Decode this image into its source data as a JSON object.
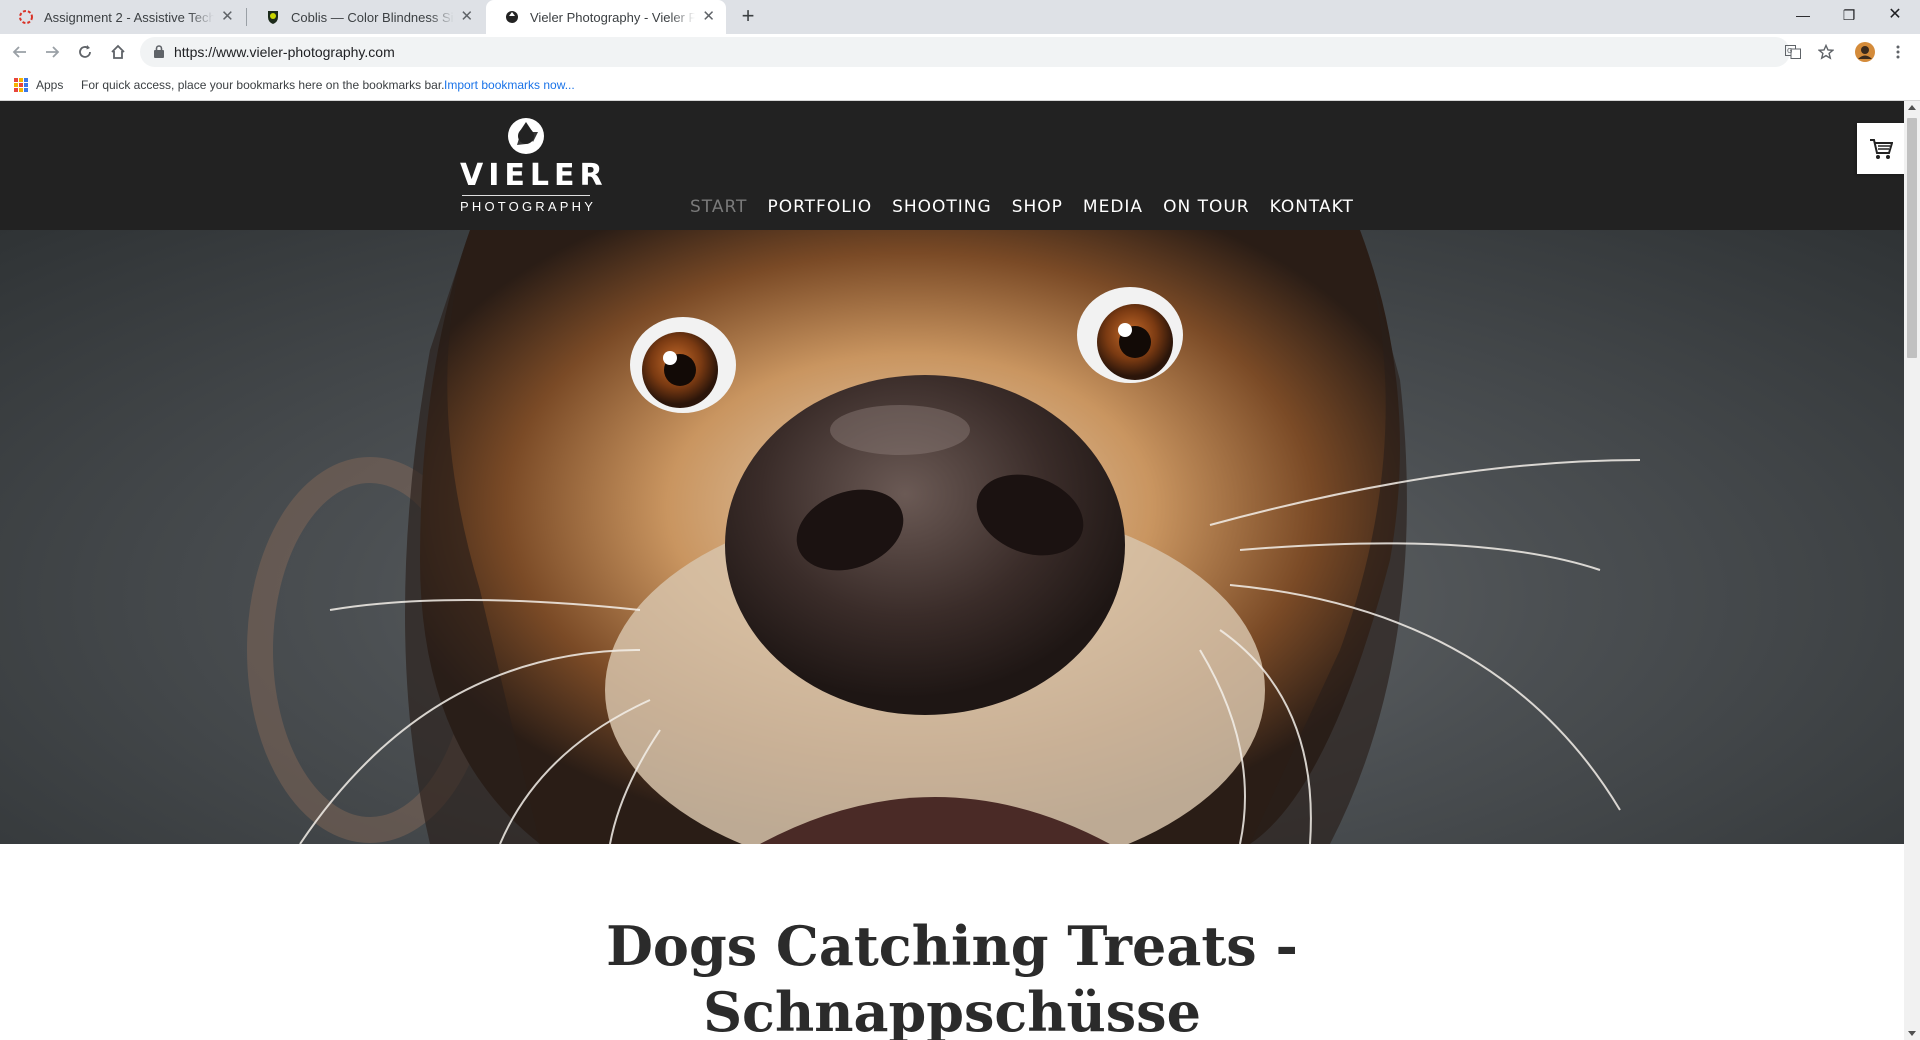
{
  "browser": {
    "tabs": [
      {
        "title": "Assignment 2 - Assistive Technology",
        "favicon": "red-ring-icon",
        "active": false
      },
      {
        "title": "Coblis — Color Blindness Simulator",
        "favicon": "coblis-icon",
        "active": false
      },
      {
        "title": "Vieler Photography - Vieler Photography",
        "favicon": "aperture-icon",
        "active": true
      }
    ],
    "url": "https://www.vieler-photography.com",
    "bookmarks_bar": {
      "apps_label": "Apps",
      "hint": "For quick access, place your bookmarks here on the bookmarks bar.",
      "import_link": "Import bookmarks now..."
    }
  },
  "site": {
    "logo": {
      "main": "VIELER",
      "sub": "PHOTOGRAPHY"
    },
    "nav": [
      {
        "label": "START",
        "current": true
      },
      {
        "label": "PORTFOLIO",
        "current": false
      },
      {
        "label": "SHOOTING",
        "current": false
      },
      {
        "label": "SHOP",
        "current": false
      },
      {
        "label": "MEDIA",
        "current": false
      },
      {
        "label": "ON TOUR",
        "current": false
      },
      {
        "label": "KONTAKT",
        "current": false
      }
    ],
    "cart_icon": "shopping-cart-icon",
    "hero_image": "dog-closeup-photo",
    "page_title_line1": "Dogs Catching Treats -",
    "page_title_line2": "Schnappschüsse"
  },
  "colors": {
    "header_bg": "#222222",
    "nav_text": "#ffffff",
    "nav_current": "#7a7a7a",
    "link_blue": "#1a73e8"
  }
}
